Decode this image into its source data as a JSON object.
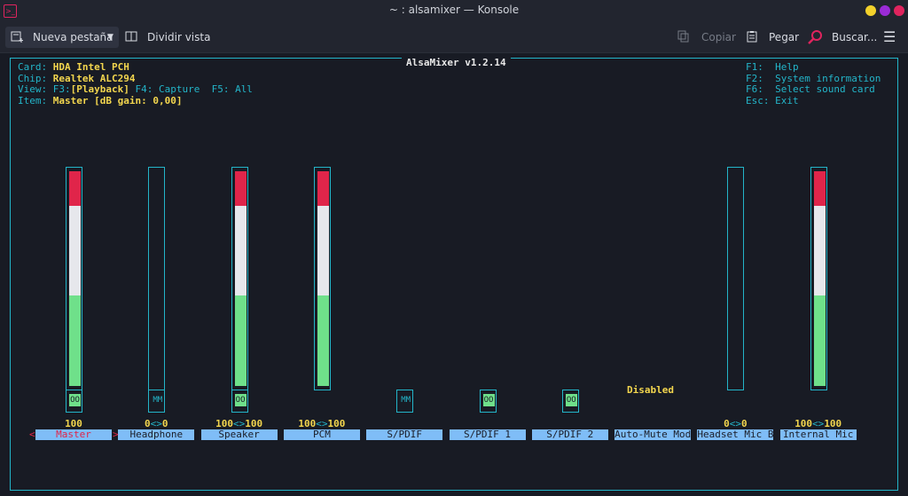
{
  "window": {
    "title": "~ : alsamixer — Konsole"
  },
  "toolbar": {
    "new_tab": "Nueva pestaña",
    "split_view": "Dividir vista",
    "copy": "Copiar",
    "paste": "Pegar",
    "find": "Buscar..."
  },
  "mixer": {
    "title": "AlsaMixer v1.2.14",
    "card_label": "Card: ",
    "card": "HDA Intel PCH",
    "chip_label": "Chip: ",
    "chip": "Realtek ALC294",
    "view_label": "View: ",
    "view_f3": "F3:",
    "view_current": "[Playback]",
    "view_others": " F4: Capture  F5: All",
    "item_label": "Item: ",
    "item": "Master [dB gain: 0,00]",
    "help": [
      "F1:  Help",
      "F2:  System information",
      "F6:  Select sound card",
      "Esc: Exit"
    ],
    "disabled_text": "Disabled",
    "channels": [
      {
        "name": "Master",
        "level": 100,
        "switch": "OO",
        "volume": "100"
      },
      {
        "name": "Headphone",
        "level": 0,
        "switch": "MM",
        "volume_l": "0",
        "arrows": "<>",
        "volume_r": "0"
      },
      {
        "name": "Speaker",
        "level": 100,
        "switch": "OO",
        "volume_l": "100",
        "arrows": "<>",
        "volume_r": "100"
      },
      {
        "name": "PCM",
        "level": 100,
        "volume_l": "100",
        "arrows": "<>",
        "volume_r": "100"
      },
      {
        "name": "S/PDIF",
        "switch": "MM"
      },
      {
        "name": "S/PDIF 1",
        "switch": "OO"
      },
      {
        "name": "S/PDIF 2",
        "switch": "OO"
      },
      {
        "name": "Auto-Mute Mod"
      },
      {
        "name": "Headset Mic B",
        "level": 0,
        "volume_l": "0",
        "arrows": "<>",
        "volume_r": "0"
      },
      {
        "name": "Internal Mic",
        "level": 100,
        "volume_l": "100",
        "arrows": "<>",
        "volume_r": "100"
      }
    ],
    "selected_markers": [
      "<",
      ">"
    ]
  },
  "colors": {
    "frame": "#23b5c9",
    "label_bg": "#7fbdf7",
    "high": "#e0254a",
    "mid": "#e6e7ec",
    "low": "#6fe08a",
    "value": "#f3d64e"
  }
}
